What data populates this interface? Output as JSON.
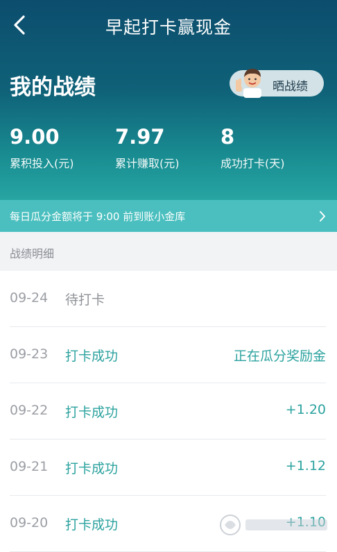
{
  "header": {
    "title": "早起打卡赢现金",
    "back_icon": "chevron-left-icon"
  },
  "hero": {
    "heading": "我的战绩",
    "share_label": "晒战绩",
    "stats": [
      {
        "value": "9.00",
        "label": "累积投入(元)"
      },
      {
        "value": "7.97",
        "label": "累计赚取(元)"
      },
      {
        "value": "8",
        "label": "成功打卡(天)"
      }
    ]
  },
  "notice": {
    "text": "每日瓜分金额将于 9:00 前到账小金库"
  },
  "records": {
    "section_title": "战绩明细",
    "items": [
      {
        "date": "09-24",
        "status": "待打卡",
        "amount": ""
      },
      {
        "date": "09-23",
        "status": "打卡成功",
        "amount": "正在瓜分奖励金"
      },
      {
        "date": "09-22",
        "status": "打卡成功",
        "amount": "+1.20"
      },
      {
        "date": "09-21",
        "status": "打卡成功",
        "amount": "+1.12"
      },
      {
        "date": "09-20",
        "status": "打卡成功",
        "amount": "+1.10"
      }
    ]
  },
  "colors": {
    "hero_top": "#0c4d6d",
    "hero_bottom": "#27a5a3",
    "notice_bg": "#4bbfbf",
    "accent": "#2aa29e",
    "muted": "#8f9297"
  }
}
